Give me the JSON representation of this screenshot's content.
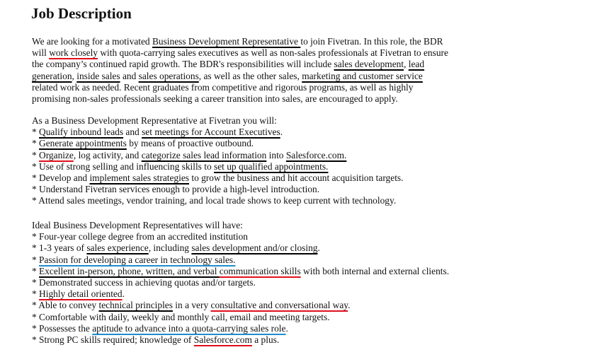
{
  "title": "Job Description",
  "paragraphs": [
    {
      "lines": [
        [
          {
            "t": "We are looking for a motivated "
          },
          {
            "t": "Business Development Representative ",
            "u": "black"
          },
          {
            "t": "to join Fivetran. In this role, the BDR"
          }
        ],
        [
          {
            "t": "will "
          },
          {
            "t": "work closely",
            "u": "red"
          },
          {
            "t": " with quota-carrying sales executives as well as non-sales professionals at Fivetran to ensure"
          }
        ],
        [
          {
            "t": "the company’s continued rapid growth. The BDR's responsibilities will include "
          },
          {
            "t": "sales development",
            "u": "black"
          },
          {
            "t": ", "
          },
          {
            "t": "lead",
            "u": "black"
          }
        ],
        [
          {
            "t": "generation",
            "u": "black"
          },
          {
            "t": ", "
          },
          {
            "t": "inside sales",
            "u": "black"
          },
          {
            "t": " and "
          },
          {
            "t": "sales operations",
            "u": "black"
          },
          {
            "t": ", as well as the other sales, "
          },
          {
            "t": "marketing and customer service",
            "u": "black"
          }
        ],
        [
          {
            "t": "related work as needed. Recent graduates from competitive and rigorous programs, as well as highly"
          }
        ],
        [
          {
            "t": "promising non-sales professionals seeking a career transition into sales, are encouraged to apply."
          }
        ]
      ]
    },
    {
      "lines": [
        [
          {
            "t": "As a Business Development Representative at Fivetran you will:"
          }
        ],
        [
          {
            "t": "* "
          },
          {
            "t": "Qualify inbound leads",
            "u": "black"
          },
          {
            "t": " and "
          },
          {
            "t": "set meetings for Account Executives",
            "u": "black"
          },
          {
            "t": "."
          }
        ],
        [
          {
            "t": "* "
          },
          {
            "t": "Generate appointments",
            "u": "black"
          },
          {
            "t": " by means of proactive outbound."
          }
        ],
        [
          {
            "t": "* "
          },
          {
            "t": "Organize",
            "u": "red"
          },
          {
            "t": ", log activity, and "
          },
          {
            "t": "categorize sales lead information",
            "u": "black"
          },
          {
            "t": " into "
          },
          {
            "t": "Salesforce.com.",
            "u": "black"
          }
        ],
        [
          {
            "t": "* Use of strong selling and influencing skills to "
          },
          {
            "t": "set up qualified appointments.",
            "u": "black"
          }
        ],
        [
          {
            "t": "* Develop and "
          },
          {
            "t": "implement sales strategies",
            "u": "black"
          },
          {
            "t": " to grow the business and hit account acquisition targets."
          }
        ],
        [
          {
            "t": "* Understand Fivetran services enough to provide a high-level introduction."
          }
        ],
        [
          {
            "t": "* Attend sales meetings, vendor training, and local trade shows to keep current with technology."
          }
        ]
      ]
    },
    {
      "lines": [
        [
          {
            "t": "Ideal Business Development Representatives will have:"
          }
        ],
        [
          {
            "t": "* Four-year college degree from an accredited institution"
          }
        ],
        [
          {
            "t": "* 1-3 years of "
          },
          {
            "t": "sales experience",
            "u": "black"
          },
          {
            "t": ", including "
          },
          {
            "t": "sales development and/or closing",
            "u": "black"
          },
          {
            "t": "."
          }
        ],
        [
          {
            "t": "* "
          },
          {
            "t": "Passion for developing a career in technology sales.",
            "u": "blue"
          }
        ],
        [
          {
            "t": "* "
          },
          {
            "t": "Excellent in-person, phone, written, and verbal ",
            "u": "black"
          },
          {
            "t": "communication skills",
            "u": "red"
          },
          {
            "t": " with both internal and external clients."
          }
        ],
        [
          {
            "t": "* Demonstrated success in achieving quotas and/or targets."
          }
        ],
        [
          {
            "t": "* "
          },
          {
            "t": "Highly detail oriented",
            "u": "red"
          },
          {
            "t": "."
          }
        ],
        [
          {
            "t": "* Able to convey "
          },
          {
            "t": "technical principles",
            "u": "black"
          },
          {
            "t": " in a very "
          },
          {
            "t": "consultative and conversational way",
            "u": "red"
          },
          {
            "t": "."
          }
        ],
        [
          {
            "t": "* Comfortable with daily, weekly and monthly call, email and meeting targets."
          }
        ],
        [
          {
            "t": "* Possesses the "
          },
          {
            "t": "aptitude to advance into a quota-carrying sales role",
            "u": "blue"
          },
          {
            "t": "."
          }
        ],
        [
          {
            "t": "* Strong PC skills required; knowledge of "
          },
          {
            "t": "Salesforce.com",
            "u": "red"
          },
          {
            "t": " a plus."
          }
        ]
      ]
    }
  ],
  "underline_colors": {
    "black": "#000000",
    "red": "#e0101c",
    "blue": "#1f8ccc"
  }
}
